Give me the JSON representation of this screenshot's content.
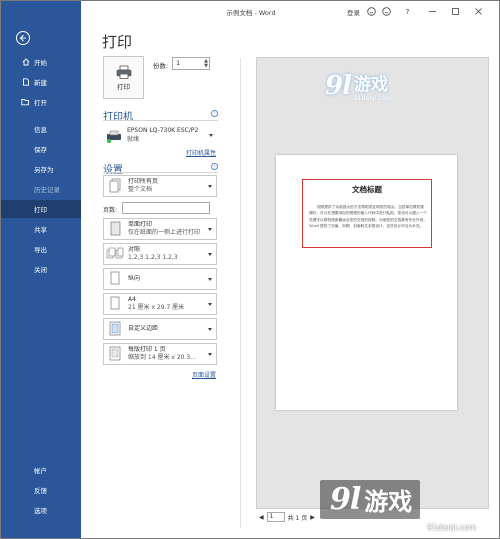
{
  "window": {
    "title": "示例文档 - Word",
    "login": "登录"
  },
  "nav": {
    "items_top": [
      {
        "label": "开始",
        "icon": "home-icon"
      },
      {
        "label": "新建",
        "icon": "new-doc-icon"
      },
      {
        "label": "打开",
        "icon": "folder-open-icon"
      }
    ],
    "items_mid": [
      {
        "label": "信息",
        "state": "normal"
      },
      {
        "label": "保存",
        "state": "normal"
      },
      {
        "label": "另存为",
        "state": "normal"
      },
      {
        "label": "历史记录",
        "state": "disabled"
      },
      {
        "label": "打印",
        "state": "active"
      },
      {
        "label": "共享",
        "state": "normal"
      },
      {
        "label": "导出",
        "state": "normal"
      },
      {
        "label": "关闭",
        "state": "normal"
      }
    ],
    "items_bottom": [
      {
        "label": "帐户"
      },
      {
        "label": "反馈"
      },
      {
        "label": "选项"
      }
    ]
  },
  "print": {
    "heading": "打印",
    "button_label": "打印",
    "copies_label": "份数:",
    "copies_value": "1",
    "printer_heading": "打印机",
    "printer_name": "EPSON LQ-730K ESC/P2",
    "printer_status": "就绪",
    "printer_properties": "打印机属性",
    "settings_heading": "设置",
    "settings": [
      {
        "main": "打印所有页",
        "sub": "整个文档"
      },
      {
        "main": "单面打印",
        "sub": "仅在纸面的一侧上进行打印"
      },
      {
        "main": "对照",
        "sub": "1,2,3    1,2,3    1,2,3"
      },
      {
        "main": "纵向",
        "sub": ""
      },
      {
        "main": "A4",
        "sub": "21 厘米 x 29.7 厘米"
      },
      {
        "main": "自定义边距",
        "sub": ""
      },
      {
        "main": "每版打印 1 页",
        "sub": "缩放到 14 厘米 x 20.3..."
      }
    ],
    "pages_label": "页数:",
    "page_setup": "页面设置"
  },
  "preview": {
    "doc_title": "文档标题",
    "doc_body": "视频提供了功能强大的方法帮助您证明您的观点。当您单击联机视频时，可以在想要添加的视频的嵌入代码中进行粘贴。您也可以键入一个关键字以联机搜索最适合您的文档的视频。为使您的文档具有专业外观，Word 提供了页眉、页脚、封面和文本框设计，这些设计可互为补充。",
    "pager_page": "1",
    "pager_total": "共 1 页"
  },
  "watermark": {
    "brand_num": "9l",
    "brand_zh": "游戏",
    "url_top": "91danji.com",
    "url_bottom": "91danji.com"
  },
  "colors": {
    "nav_bg": "#2b579a",
    "nav_active": "#1e3f70",
    "accent": "#2b579a",
    "frame": "#d23a3a"
  }
}
